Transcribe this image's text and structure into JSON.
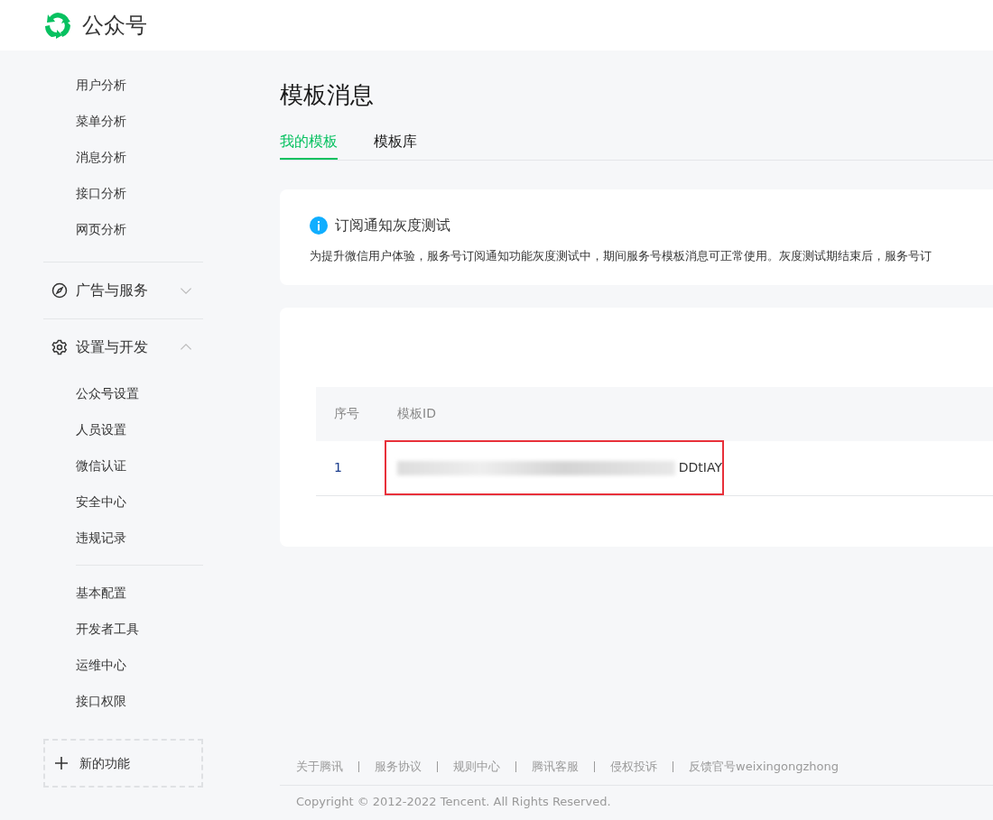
{
  "header": {
    "brand": "公众号"
  },
  "sidebar": {
    "analysis_items": [
      "用户分析",
      "菜单分析",
      "消息分析",
      "接口分析",
      "网页分析"
    ],
    "sections": [
      {
        "label": "广告与服务",
        "expanded": false
      },
      {
        "label": "设置与开发",
        "expanded": true,
        "groups": [
          {
            "items": [
              "公众号设置",
              "人员设置",
              "微信认证",
              "安全中心",
              "违规记录"
            ]
          },
          {
            "items": [
              "基本配置",
              "开发者工具",
              "运维中心",
              "接口权限"
            ]
          }
        ]
      }
    ],
    "new_feature": {
      "label": "新的功能"
    }
  },
  "page": {
    "title": "模板消息",
    "tabs": [
      {
        "label": "我的模板",
        "selected": true
      },
      {
        "label": "模板库",
        "selected": false
      }
    ],
    "notice": {
      "title": "订阅通知灰度测试",
      "text": "为提升微信用户体验，服务号订阅通知功能灰度测试中，期间服务号模板消息可正常使用。灰度测试期结束后，服务号订"
    },
    "table": {
      "columns": [
        "序号",
        "模板ID"
      ],
      "rows": [
        {
          "index": "1",
          "template_id": "DDtIAY",
          "redacted": true,
          "highlighted": true
        }
      ]
    }
  },
  "footer": {
    "links": [
      "关于腾讯",
      "服务协议",
      "规则中心",
      "腾讯客服",
      "侵权投诉",
      "反馈官号weixingongzhong"
    ],
    "copyright": "Copyright © 2012-2022 Tencent. All Rights Reserved."
  }
}
